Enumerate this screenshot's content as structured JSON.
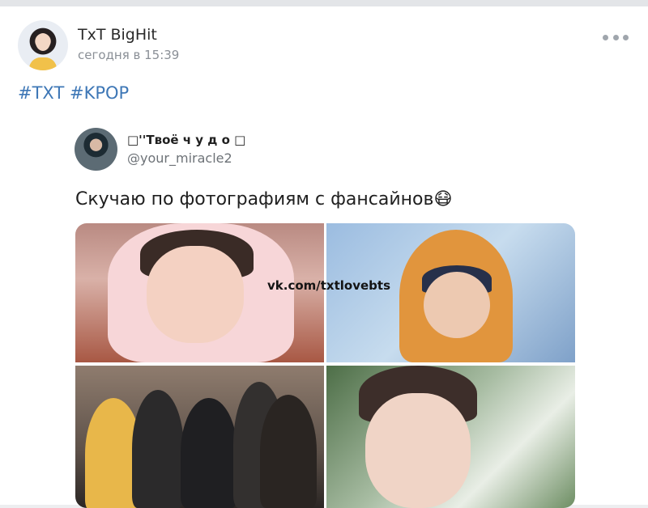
{
  "post": {
    "author_name": "TxT BigHit",
    "date": "сегодня в 15:39",
    "hashtags": [
      "#TXT",
      "#KPOP"
    ]
  },
  "tweet": {
    "display_name": "□''Твоё ч у д о □",
    "handle": "@your_miracle2",
    "text": "Скучаю по фотографиям с фансайнов😷"
  },
  "media": {
    "watermark": "vk.com/txtlovebts"
  },
  "icons": {
    "more": "more-horizontal-icon"
  }
}
